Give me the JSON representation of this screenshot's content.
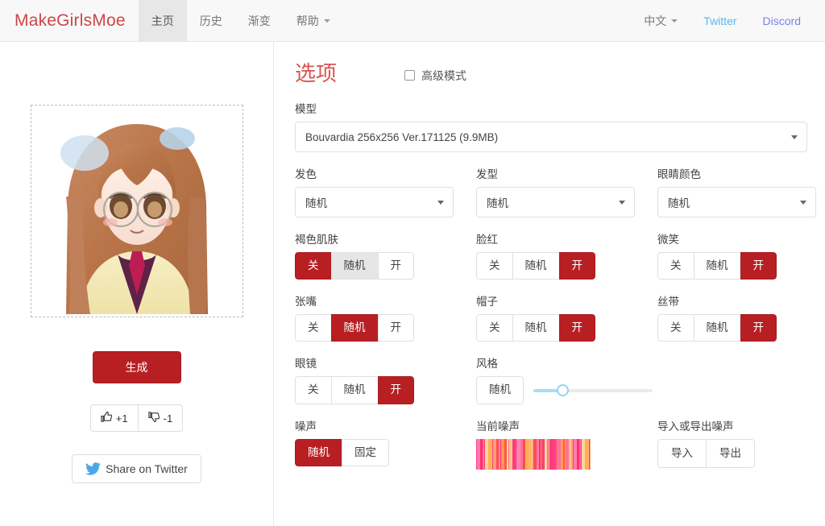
{
  "navbar": {
    "brand": "MakeGirlsMoe",
    "items": [
      {
        "label": "主页",
        "active": true
      },
      {
        "label": "历史",
        "active": false
      },
      {
        "label": "渐变",
        "active": false
      },
      {
        "label": "帮助",
        "active": false,
        "caret": true
      }
    ],
    "right": [
      {
        "label": "中文",
        "caret": true,
        "kind": "lang"
      },
      {
        "label": "Twitter",
        "kind": "twitter"
      },
      {
        "label": "Discord",
        "kind": "discord"
      }
    ]
  },
  "left": {
    "generate_label": "生成",
    "upvote_label": "+1",
    "downvote_label": "-1",
    "share_label": "Share on Twitter",
    "upvote_icon": "thumbs-up-icon",
    "downvote_icon": "thumbs-down-icon",
    "share_icon": "twitter-bird-icon",
    "result_image_alt": "generated-anime-portrait"
  },
  "options": {
    "title": "选项",
    "advanced_label": "高级模式",
    "advanced_checked": false,
    "model": {
      "label": "模型",
      "value": "Bouvardia 256x256 Ver.171125 (9.9MB)"
    },
    "selects": [
      {
        "label": "发色",
        "value": "随机"
      },
      {
        "label": "发型",
        "value": "随机"
      },
      {
        "label": "眼睛颜色",
        "value": "随机"
      }
    ],
    "toggles": [
      {
        "label": "褐色肌肤",
        "options": [
          "关",
          "随机",
          "开"
        ],
        "selected": 0,
        "hover": 1
      },
      {
        "label": "脸红",
        "options": [
          "关",
          "随机",
          "开"
        ],
        "selected": 2,
        "hover": -1
      },
      {
        "label": "微笑",
        "options": [
          "关",
          "随机",
          "开"
        ],
        "selected": 2,
        "hover": -1
      },
      {
        "label": "张嘴",
        "options": [
          "关",
          "随机",
          "开"
        ],
        "selected": 1,
        "hover": -1
      },
      {
        "label": "帽子",
        "options": [
          "关",
          "随机",
          "开"
        ],
        "selected": 2,
        "hover": -1
      },
      {
        "label": "丝带",
        "options": [
          "关",
          "随机",
          "开"
        ],
        "selected": 2,
        "hover": -1
      },
      {
        "label": "眼镜",
        "options": [
          "关",
          "随机",
          "开"
        ],
        "selected": 2,
        "hover": -1
      }
    ],
    "style": {
      "label": "风格",
      "button_label": "随机",
      "slider_value": 24
    },
    "noise": {
      "label": "噪声",
      "options": [
        "随机",
        "固定"
      ],
      "selected": 0
    },
    "current_noise": {
      "label": "当前噪声",
      "icon": "noise-stripes-preview"
    },
    "noise_io": {
      "label": "导入或导出噪声",
      "import_label": "导入",
      "export_label": "导出"
    }
  }
}
